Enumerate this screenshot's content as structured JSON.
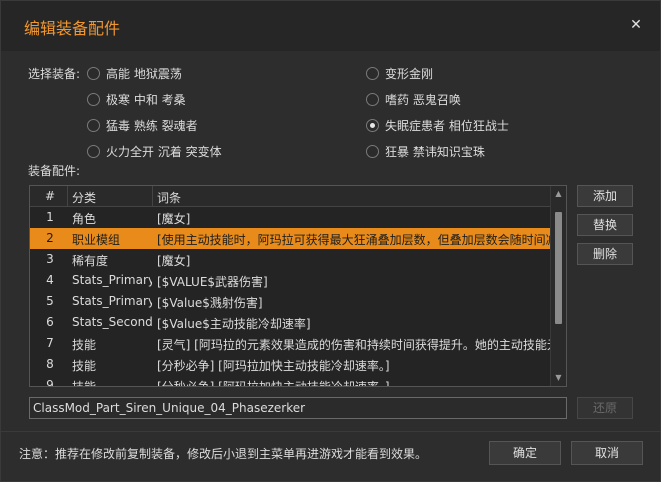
{
  "title": "编辑装备配件",
  "close_label": "✕",
  "select_label": "选择装备:",
  "equipment_left": [
    {
      "label": "高能 地狱震荡",
      "checked": false
    },
    {
      "label": "极寒 中和 考桑",
      "checked": false
    },
    {
      "label": "猛毒 熟练 裂魂者",
      "checked": false
    },
    {
      "label": "火力全开 沉着 突变体",
      "checked": false
    }
  ],
  "equipment_right": [
    {
      "label": "变形金刚",
      "checked": false
    },
    {
      "label": "嗜药 恶鬼召唤",
      "checked": false
    },
    {
      "label": "失眠症患者 相位狂战士",
      "checked": true
    },
    {
      "label": "狂暴 禁讳知识宝珠",
      "checked": false
    }
  ],
  "parts_label": "装备配件:",
  "table": {
    "headers": [
      "#",
      "分类",
      "词条"
    ],
    "rows": [
      {
        "num": "1",
        "category": "角色",
        "term": "[魔女]",
        "selected": false
      },
      {
        "num": "2",
        "category": "职业模组",
        "term": "[使用主动技能时，阿玛拉可获得最大狂涌叠加层数，但叠加层数会随时间减",
        "selected": true
      },
      {
        "num": "3",
        "category": "稀有度",
        "term": "[魔女]",
        "selected": false
      },
      {
        "num": "4",
        "category": "Stats_Primary",
        "term": "[$VALUE$武器伤害]",
        "selected": false
      },
      {
        "num": "5",
        "category": "Stats_Primary",
        "term": "[$Value$溅射伤害]",
        "selected": false
      },
      {
        "num": "6",
        "category": "Stats_Seconda",
        "term": "[$Value$主动技能冷却速率]",
        "selected": false
      },
      {
        "num": "7",
        "category": "技能",
        "term": "[灵气] [阿玛拉的元素效果造成的伤害和持续时间获得提升。她的主动技能元",
        "selected": false
      },
      {
        "num": "8",
        "category": "技能",
        "term": "[分秒必争] [阿玛拉加快主动技能冷却速率。]",
        "selected": false
      },
      {
        "num": "9",
        "category": "技能",
        "term": "[分秒必争] [阿玛拉加快主动技能冷却速率。]",
        "selected": false
      }
    ]
  },
  "buttons": {
    "add": "添加",
    "replace": "替换",
    "delete": "删除",
    "restore": "还原",
    "ok": "确定",
    "cancel": "取消"
  },
  "part_id_value": "ClassMod_Part_Siren_Unique_04_Phasezerker",
  "note": "注意：推荐在修改前复制装备，修改后小退到主菜单再进游戏才能看到效果。",
  "colors": {
    "accent": "#f0962f",
    "selection": "#e88b1a"
  }
}
